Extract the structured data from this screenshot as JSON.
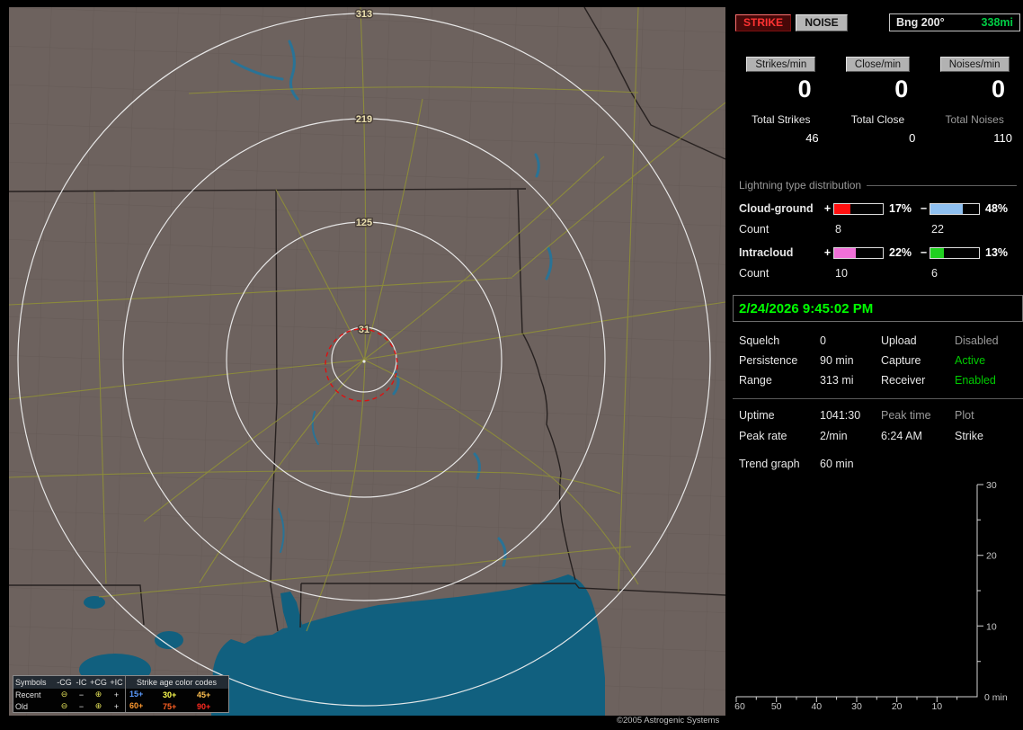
{
  "map": {
    "ring_labels": [
      "313",
      "219",
      "125",
      "31"
    ],
    "copyright": "©2005 Astrogenic Systems",
    "legend": {
      "symbols_title": "Symbols",
      "symbol_cols": [
        "-CG",
        "-IC",
        "+CG",
        "+IC"
      ],
      "age_title": "Strike age color codes",
      "rows": [
        {
          "label": "Recent",
          "symbols": [
            "⊖",
            "−",
            "⊕",
            "+"
          ],
          "ages": [
            "15+",
            "30+",
            "45+"
          ],
          "age_styles": [
            "color:#5b9bff",
            "color:#ffff50",
            "color:#ffc050"
          ]
        },
        {
          "label": "Old",
          "symbols": [
            "⊖",
            "−",
            "⊕",
            "+"
          ],
          "ages": [
            "60+",
            "75+",
            "90+"
          ],
          "age_styles": [
            "color:#ff9a30",
            "color:#ff6022",
            "color:#ff2a20"
          ]
        }
      ]
    }
  },
  "panel": {
    "header": {
      "strike": "STRIKE",
      "noise": "NOISE",
      "bearing_label": "Bng 200°",
      "bearing_range": "338mi"
    },
    "rates": [
      {
        "label": "Strikes/min",
        "value": "0"
      },
      {
        "label": "Close/min",
        "value": "0"
      },
      {
        "label": "Noises/min",
        "value": "0"
      }
    ],
    "totals": [
      {
        "label": "Total Strikes",
        "value": "46"
      },
      {
        "label": "Total Close",
        "value": "0"
      },
      {
        "label": "Total Noises",
        "value": "110",
        "label_style": "color:#9c9c9c"
      }
    ],
    "distribution": {
      "title": "Lightning type distribution",
      "rows": [
        {
          "label": "Cloud-ground",
          "plus_sign": "+",
          "plus_pct": "17%",
          "plus_bar_style": "width:33%;background:#ff1010",
          "minus_sign": "−",
          "minus_pct": "48%",
          "minus_bar_style": "width:67%;background:#8fc0f0",
          "count_label": "Count",
          "plus_count": "8",
          "minus_count": "22"
        },
        {
          "label": "Intracloud",
          "plus_sign": "+",
          "plus_pct": "22%",
          "plus_bar_style": "width:44%;background:#f070d8",
          "minus_sign": "−",
          "minus_pct": "13%",
          "minus_bar_style": "width:27%;background:#20d020",
          "count_label": "Count",
          "plus_count": "10",
          "minus_count": "6"
        }
      ]
    },
    "datetime": "2/24/2026 9:45:02 PM",
    "settings": {
      "rows": [
        {
          "label": "Squelch",
          "value": "0",
          "label2": "Upload",
          "value2": "Disabled",
          "value2_style": "color:#9a9a9a"
        },
        {
          "label": "Persistence",
          "value": "90 min",
          "label2": "Capture",
          "value2": "Active",
          "value2_style": "color:#00cc00"
        },
        {
          "label": "Range",
          "value": "313 mi",
          "label2": "Receiver",
          "value2": "Enabled",
          "value2_style": "color:#00cc00"
        }
      ]
    },
    "stats": {
      "rows": [
        {
          "c1": "Uptime",
          "c2": "1041:30",
          "c3": "Peak time",
          "c4": "Plot",
          "c3_style": "color:#9a9a9a",
          "c4_style": "color:#9a9a9a"
        },
        {
          "c1": "Peak rate",
          "c2": "2/min",
          "c3": "6:24 AM",
          "c4": "Strike"
        }
      ]
    },
    "trend": {
      "label": "Trend graph",
      "value": "60 min"
    },
    "chart": {
      "type": "line",
      "title": "Trend graph",
      "window": "60 min",
      "y_ticks": [
        "30",
        "20",
        "10"
      ],
      "x_ticks": [
        "60",
        "50",
        "40",
        "30",
        "20",
        "10"
      ],
      "origin_label": "0 min",
      "ylim": [
        0,
        30
      ],
      "xlim_minutes_ago": [
        60,
        0
      ],
      "series": []
    },
    "colors": {
      "active_green": "#00cc00",
      "clock_green": "#00ff00",
      "strike_red": "#ff3333",
      "disabled_gray": "#9a9a9a"
    }
  }
}
